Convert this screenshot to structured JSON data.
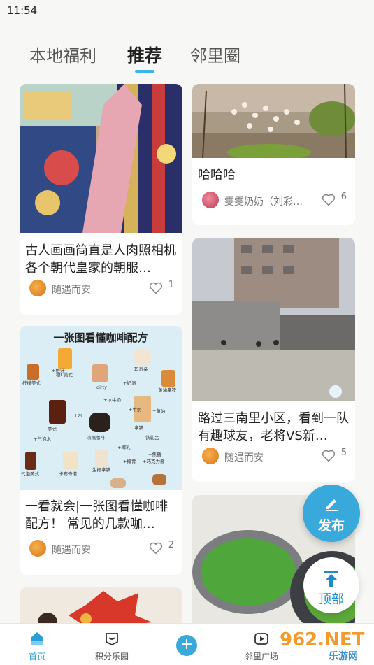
{
  "status": {
    "time": "11:54"
  },
  "tabs": [
    {
      "label": "本地福利"
    },
    {
      "label": "推荐"
    },
    {
      "label": "邻里圈"
    }
  ],
  "cards": [
    {
      "title": "古人画画简直是人肉照相机 各个朝代皇家的朝服…",
      "author": "随遇而安",
      "likes": "1"
    },
    {
      "image_title": "一张图看懂咖啡配方",
      "title": "一看就会|一张图看懂咖啡配方！ 常见的几款咖…",
      "author": "随遇而安",
      "likes": "2",
      "coffee_labels": [
        "柠檬美式",
        "橙C美式",
        "dirty",
        "玛奇朵",
        "黄油拿铁",
        "美式",
        "浓缩咖啡",
        "拿铁",
        "气泡美式",
        "卡布奇诺",
        "生椰拿铁",
        "+橙汁",
        "+奶泡",
        "+冰牛奶",
        "+水",
        "+牛奶",
        "+黄油",
        "+椰乳",
        "+气泡水",
        "+焦糖",
        "+巧克力酱",
        "铁乳吕",
        "+椰青"
      ]
    },
    {
      "title": "哈哈哈",
      "author": "雯雯奶奶（刘彩…",
      "likes": "6"
    },
    {
      "title": "路过三南里小区，看到一队有趣球友，老将VS新…",
      "author": "随遇而安",
      "likes": "5"
    }
  ],
  "fab": {
    "post_label": "发布",
    "top_label": "顶部"
  },
  "bottom_nav": [
    {
      "label": "首页"
    },
    {
      "label": "积分乐园"
    },
    {
      "label": "邻里广场"
    }
  ],
  "watermark": {
    "number": "962.NET",
    "sub": "乐游网"
  },
  "colors": {
    "accent": "#39a9dc",
    "indicator": "#3cb5e4"
  }
}
